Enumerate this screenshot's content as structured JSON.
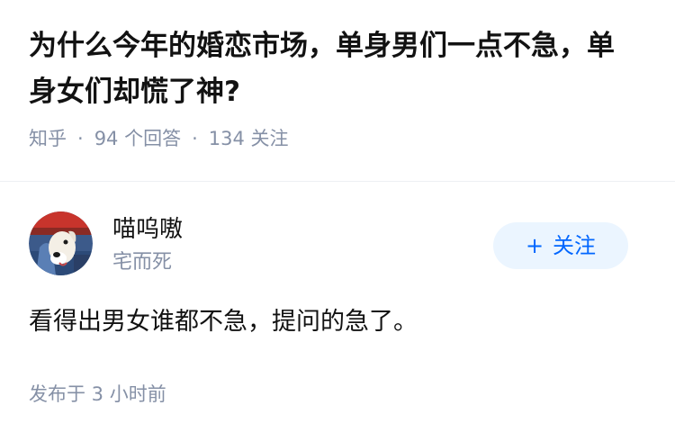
{
  "question": {
    "title": "为什么今年的婚恋市场，单身男们一点不急，单身女们却慌了神?",
    "source": "知乎",
    "answers_count": "94 个回答",
    "followers_count": "134 关注"
  },
  "answer": {
    "author": {
      "name": "喵呜嗷",
      "bio": "宅而死",
      "avatar_icon": "avatar-image-icon"
    },
    "follow_button": {
      "plus": "+",
      "label": "关注"
    },
    "content": "看得出男女谁都不急，提问的急了。",
    "publish_time": "发布于 3 小时前"
  },
  "colors": {
    "primary_text": "#121212",
    "secondary_text": "#8590a6",
    "accent": "#0066ff",
    "accent_bg": "#ebf5ff"
  }
}
